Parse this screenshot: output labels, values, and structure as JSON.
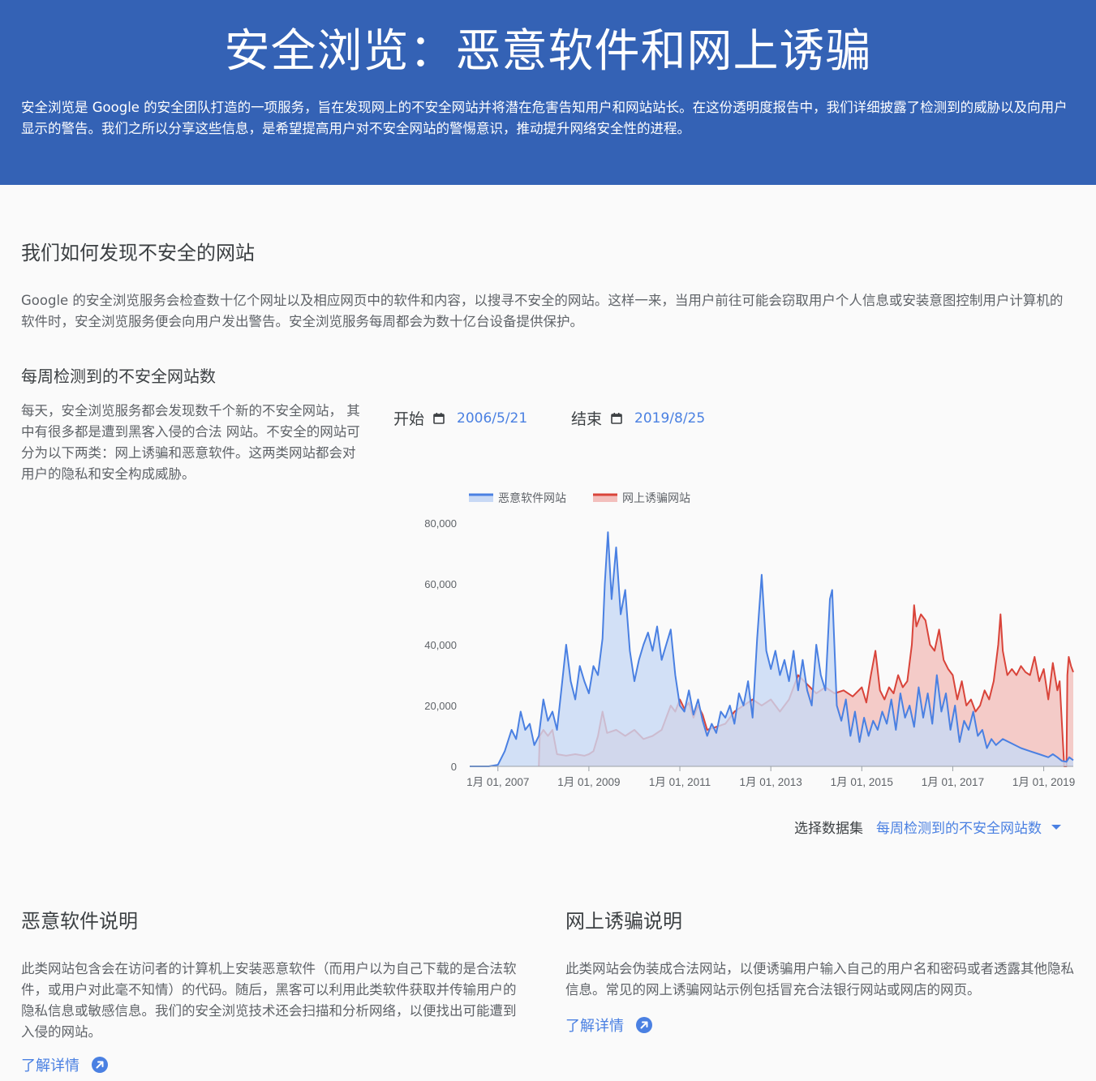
{
  "header": {
    "title": "安全浏览：恶意软件和网上诱骗",
    "description": "安全浏览是 Google 的安全团队打造的一项服务，旨在发现网上的不安全网站并将潜在危害告知用户和网站站长。在这份透明度报告中，我们详细披露了检测到的威胁以及向用户显示的警告。我们之所以分享这些信息，是希望提高用户对不安全网站的警惕意识，推动提升网络安全性的进程。"
  },
  "how": {
    "title": "我们如何发现不安全的网站",
    "body": "Google 的安全浏览服务会检查数十亿个网址以及相应网页中的软件和内容，以搜寻不安全的网站。这样一来，当用户前往可能会窃取用户个人信息或安装意图控制用户计算机的软件时，安全浏览服务便会向用户发出警告。安全浏览服务每周都会为数十亿台设备提供保护。"
  },
  "weekly": {
    "title": "每周检测到的不安全网站数",
    "body": "每天，安全浏览服务都会发现数千个新的不安全网站， 其中有很多都是遭到黑客入侵的合法 网站。不安全的网站可分为以下两类：网上诱骗和恶意软件。这两类网站都会对 用户的隐私和安全构成威胁。"
  },
  "date_range": {
    "start_label": "开始",
    "start_value": "2006/5/21",
    "end_label": "结束",
    "end_value": "2019/8/25",
    "icon": "calendar-icon"
  },
  "dataset_selector": {
    "label": "选择数据集",
    "value": "每周检测到的不安全网站数",
    "icon": "chevron-down-icon"
  },
  "malware": {
    "title": "恶意软件说明",
    "body": "此类网站包含会在访问者的计算机上安装恶意软件（而用户以为自己下载的是合法软件，或用户对此毫不知情）的代码。随后，黑客可以利用此类软件获取并传输用户的隐私信息或敏感信息。我们的安全浏览技术还会扫描和分析网络，以便找出可能遭到入侵的网站。",
    "link": "了解详情"
  },
  "phishing": {
    "title": "网上诱骗说明",
    "body": "此类网站会伪装成合法网站，以便诱骗用户输入自己的用户名和密码或者透露其他隐私信息。常见的网上诱骗网站示例包括冒充合法银行网站或网店的网页。",
    "link": "了解详情"
  },
  "colors": {
    "header_bg": "#3462b5",
    "malware": "#4a80e2",
    "malware_fill": "#c8d9f5",
    "phishing": "#d9443a",
    "phishing_fill": "#f3bfbc",
    "link": "#4a80e2"
  },
  "chart_data": {
    "type": "area",
    "x_ticks": [
      "1月 01, 2007",
      "1月 01, 2009",
      "1月 01, 2011",
      "1月 01, 2013",
      "1月 01, 2015",
      "1月 01, 2017",
      "1月 01, 2019"
    ],
    "y_ticks": [
      "0",
      "20,000",
      "40,000",
      "60,000",
      "80,000"
    ],
    "ylim": [
      0,
      80000
    ],
    "xlim": [
      2006.38,
      2019.65
    ],
    "legend_position": "top-left",
    "series": [
      {
        "name": "恶意软件网站",
        "color": "#4a80e2",
        "points": [
          [
            2006.38,
            0
          ],
          [
            2006.6,
            0
          ],
          [
            2006.8,
            0
          ],
          [
            2007.0,
            500
          ],
          [
            2007.15,
            5000
          ],
          [
            2007.3,
            12000
          ],
          [
            2007.4,
            9000
          ],
          [
            2007.5,
            18000
          ],
          [
            2007.6,
            12000
          ],
          [
            2007.7,
            14000
          ],
          [
            2007.8,
            7000
          ],
          [
            2007.9,
            10000
          ],
          [
            2008.0,
            22000
          ],
          [
            2008.1,
            15000
          ],
          [
            2008.2,
            18000
          ],
          [
            2008.3,
            12000
          ],
          [
            2008.4,
            26000
          ],
          [
            2008.5,
            40000
          ],
          [
            2008.6,
            28000
          ],
          [
            2008.7,
            22000
          ],
          [
            2008.8,
            33000
          ],
          [
            2008.9,
            28000
          ],
          [
            2009.0,
            24000
          ],
          [
            2009.1,
            33000
          ],
          [
            2009.2,
            30000
          ],
          [
            2009.3,
            42000
          ],
          [
            2009.35,
            60000
          ],
          [
            2009.42,
            77000
          ],
          [
            2009.5,
            55000
          ],
          [
            2009.6,
            72000
          ],
          [
            2009.7,
            50000
          ],
          [
            2009.8,
            58000
          ],
          [
            2009.9,
            38000
          ],
          [
            2010.0,
            28000
          ],
          [
            2010.1,
            35000
          ],
          [
            2010.2,
            40000
          ],
          [
            2010.3,
            44000
          ],
          [
            2010.4,
            38000
          ],
          [
            2010.5,
            46000
          ],
          [
            2010.6,
            35000
          ],
          [
            2010.7,
            40000
          ],
          [
            2010.8,
            45000
          ],
          [
            2010.9,
            30000
          ],
          [
            2011.0,
            20000
          ],
          [
            2011.1,
            18000
          ],
          [
            2011.2,
            25000
          ],
          [
            2011.3,
            17000
          ],
          [
            2011.4,
            22000
          ],
          [
            2011.5,
            15000
          ],
          [
            2011.6,
            10000
          ],
          [
            2011.7,
            14000
          ],
          [
            2011.8,
            11000
          ],
          [
            2011.9,
            18000
          ],
          [
            2012.0,
            16000
          ],
          [
            2012.1,
            20000
          ],
          [
            2012.2,
            14000
          ],
          [
            2012.3,
            24000
          ],
          [
            2012.4,
            20000
          ],
          [
            2012.5,
            28000
          ],
          [
            2012.6,
            16000
          ],
          [
            2012.7,
            42000
          ],
          [
            2012.8,
            63000
          ],
          [
            2012.9,
            38000
          ],
          [
            2013.0,
            32000
          ],
          [
            2013.1,
            38000
          ],
          [
            2013.2,
            30000
          ],
          [
            2013.3,
            35000
          ],
          [
            2013.4,
            28000
          ],
          [
            2013.5,
            38000
          ],
          [
            2013.6,
            25000
          ],
          [
            2013.7,
            35000
          ],
          [
            2013.8,
            25000
          ],
          [
            2013.9,
            20000
          ],
          [
            2014.0,
            40000
          ],
          [
            2014.1,
            30000
          ],
          [
            2014.2,
            25000
          ],
          [
            2014.3,
            55000
          ],
          [
            2014.35,
            58000
          ],
          [
            2014.45,
            20000
          ],
          [
            2014.55,
            15000
          ],
          [
            2014.65,
            22000
          ],
          [
            2014.75,
            10000
          ],
          [
            2014.85,
            18000
          ],
          [
            2014.95,
            8000
          ],
          [
            2015.05,
            16000
          ],
          [
            2015.15,
            10000
          ],
          [
            2015.25,
            15000
          ],
          [
            2015.35,
            12000
          ],
          [
            2015.45,
            18000
          ],
          [
            2015.55,
            14000
          ],
          [
            2015.65,
            22000
          ],
          [
            2015.75,
            12000
          ],
          [
            2015.85,
            24000
          ],
          [
            2015.95,
            16000
          ],
          [
            2016.05,
            20000
          ],
          [
            2016.15,
            13000
          ],
          [
            2016.25,
            26000
          ],
          [
            2016.35,
            16000
          ],
          [
            2016.45,
            24000
          ],
          [
            2016.55,
            14000
          ],
          [
            2016.65,
            30000
          ],
          [
            2016.75,
            18000
          ],
          [
            2016.85,
            24000
          ],
          [
            2016.95,
            12000
          ],
          [
            2017.05,
            20000
          ],
          [
            2017.15,
            8000
          ],
          [
            2017.25,
            15000
          ],
          [
            2017.35,
            12000
          ],
          [
            2017.45,
            18000
          ],
          [
            2017.55,
            10000
          ],
          [
            2017.65,
            12000
          ],
          [
            2017.75,
            6000
          ],
          [
            2017.85,
            9000
          ],
          [
            2017.95,
            7000
          ],
          [
            2018.1,
            9000
          ],
          [
            2018.3,
            7500
          ],
          [
            2018.5,
            6000
          ],
          [
            2018.7,
            5000
          ],
          [
            2018.9,
            4000
          ],
          [
            2019.1,
            3000
          ],
          [
            2019.2,
            4000
          ],
          [
            2019.3,
            3000
          ],
          [
            2019.4,
            1800
          ],
          [
            2019.5,
            1500
          ],
          [
            2019.56,
            3000
          ],
          [
            2019.65,
            2000
          ]
        ]
      },
      {
        "name": "网上诱骗网站",
        "color": "#d9443a",
        "points": [
          [
            2007.9,
            0
          ],
          [
            2007.92,
            10000
          ],
          [
            2008.0,
            12000
          ],
          [
            2008.1,
            10000
          ],
          [
            2008.2,
            12000
          ],
          [
            2008.3,
            4000
          ],
          [
            2008.5,
            3500
          ],
          [
            2008.7,
            4000
          ],
          [
            2008.9,
            3500
          ],
          [
            2009.0,
            4000
          ],
          [
            2009.1,
            5000
          ],
          [
            2009.2,
            10000
          ],
          [
            2009.3,
            18000
          ],
          [
            2009.4,
            11000
          ],
          [
            2009.6,
            12000
          ],
          [
            2009.8,
            10000
          ],
          [
            2010.0,
            12000
          ],
          [
            2010.2,
            9000
          ],
          [
            2010.4,
            10000
          ],
          [
            2010.6,
            12000
          ],
          [
            2010.8,
            20000
          ],
          [
            2010.9,
            18000
          ],
          [
            2011.0,
            22000
          ],
          [
            2011.1,
            19000
          ],
          [
            2011.2,
            21000
          ],
          [
            2011.3,
            16000
          ],
          [
            2011.4,
            20000
          ],
          [
            2011.5,
            17000
          ],
          [
            2011.6,
            12000
          ],
          [
            2011.8,
            13000
          ],
          [
            2012.0,
            14000
          ],
          [
            2012.2,
            18000
          ],
          [
            2012.4,
            20000
          ],
          [
            2012.6,
            22000
          ],
          [
            2012.8,
            20000
          ],
          [
            2013.0,
            22000
          ],
          [
            2013.2,
            18000
          ],
          [
            2013.4,
            22000
          ],
          [
            2013.6,
            30000
          ],
          [
            2013.8,
            27000
          ],
          [
            2014.0,
            24000
          ],
          [
            2014.2,
            26000
          ],
          [
            2014.4,
            24000
          ],
          [
            2014.6,
            25000
          ],
          [
            2014.8,
            23000
          ],
          [
            2015.0,
            26000
          ],
          [
            2015.1,
            21000
          ],
          [
            2015.2,
            30000
          ],
          [
            2015.3,
            38000
          ],
          [
            2015.4,
            25000
          ],
          [
            2015.5,
            22000
          ],
          [
            2015.6,
            26000
          ],
          [
            2015.7,
            24000
          ],
          [
            2015.8,
            30000
          ],
          [
            2015.9,
            26000
          ],
          [
            2016.0,
            28000
          ],
          [
            2016.1,
            40000
          ],
          [
            2016.15,
            53000
          ],
          [
            2016.2,
            46000
          ],
          [
            2016.3,
            50000
          ],
          [
            2016.4,
            48000
          ],
          [
            2016.5,
            40000
          ],
          [
            2016.6,
            38000
          ],
          [
            2016.7,
            45000
          ],
          [
            2016.8,
            35000
          ],
          [
            2016.9,
            32000
          ],
          [
            2017.0,
            30000
          ],
          [
            2017.1,
            22000
          ],
          [
            2017.2,
            28000
          ],
          [
            2017.3,
            20000
          ],
          [
            2017.4,
            22000
          ],
          [
            2017.5,
            18000
          ],
          [
            2017.6,
            20000
          ],
          [
            2017.7,
            25000
          ],
          [
            2017.8,
            22000
          ],
          [
            2017.9,
            28000
          ],
          [
            2018.0,
            40000
          ],
          [
            2018.05,
            50000
          ],
          [
            2018.1,
            38000
          ],
          [
            2018.2,
            30000
          ],
          [
            2018.3,
            32000
          ],
          [
            2018.4,
            30000
          ],
          [
            2018.5,
            33000
          ],
          [
            2018.6,
            31000
          ],
          [
            2018.7,
            30000
          ],
          [
            2018.8,
            36000
          ],
          [
            2018.9,
            28000
          ],
          [
            2019.0,
            32000
          ],
          [
            2019.1,
            22000
          ],
          [
            2019.2,
            34000
          ],
          [
            2019.3,
            25000
          ],
          [
            2019.35,
            28000
          ],
          [
            2019.45,
            0
          ],
          [
            2019.5,
            0
          ],
          [
            2019.52,
            30000
          ],
          [
            2019.55,
            36000
          ],
          [
            2019.6,
            33000
          ],
          [
            2019.65,
            31000
          ]
        ]
      }
    ]
  }
}
